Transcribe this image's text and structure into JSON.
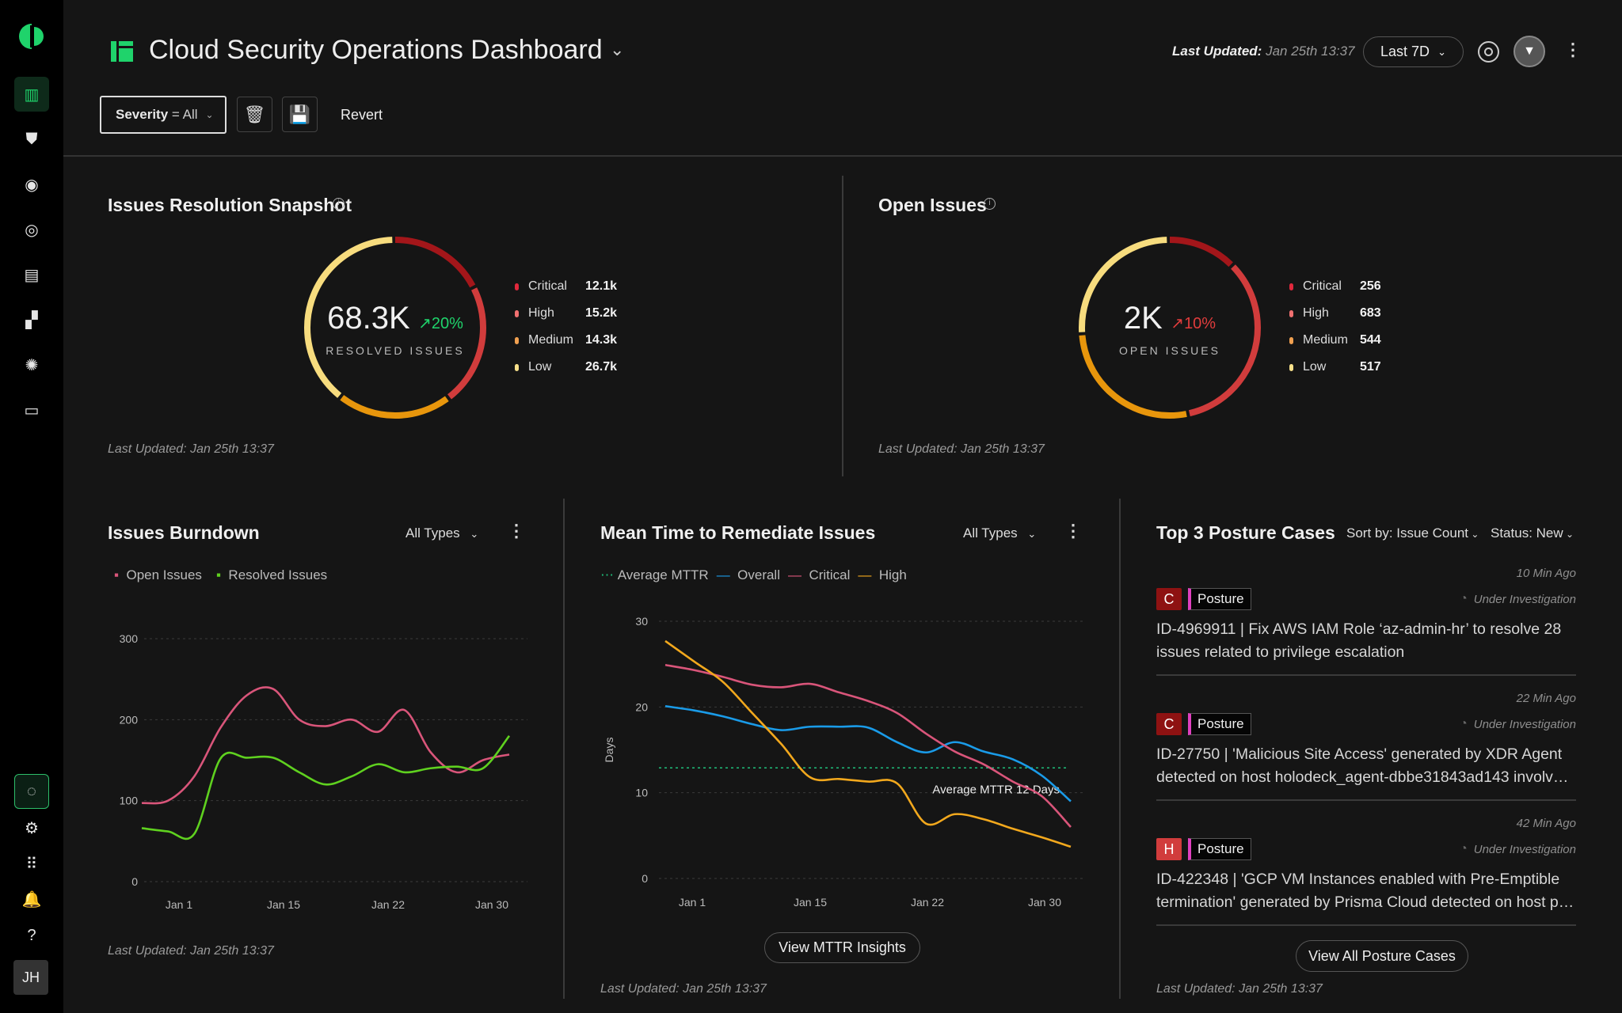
{
  "sidebar": {
    "items": [
      {
        "icon": "dashboard-icon",
        "glyph": "▥",
        "active": true
      },
      {
        "icon": "shield-alert-icon",
        "glyph": "⛊"
      },
      {
        "icon": "eye-icon",
        "glyph": "◉"
      },
      {
        "icon": "target-icon",
        "glyph": "◎"
      },
      {
        "icon": "clipboard-icon",
        "glyph": "▤"
      },
      {
        "icon": "modules-icon",
        "glyph": "▞"
      },
      {
        "icon": "network-icon",
        "glyph": "✺"
      },
      {
        "icon": "inbox-icon",
        "glyph": "▭"
      }
    ],
    "bottom": [
      {
        "icon": "radar-icon",
        "glyph": "◌"
      },
      {
        "icon": "gear-icon",
        "glyph": "⚙"
      },
      {
        "icon": "apps-grid-icon",
        "glyph": "⠿"
      },
      {
        "icon": "bell-icon",
        "glyph": "🔔"
      },
      {
        "icon": "help-icon",
        "glyph": "?"
      }
    ],
    "avatar": "JH"
  },
  "header": {
    "title": "Cloud Security Operations Dashboard",
    "last_updated_label": "Last Updated:",
    "last_updated_value": "Jan 25th 13:37",
    "range": "Last 7D"
  },
  "filters": {
    "severity_label": "Severity",
    "severity_value": "= All",
    "revert": "Revert"
  },
  "colors": {
    "accent": "#1fd36b",
    "critical": "#a3161a",
    "high": "#d13c3c",
    "medium": "#e8960c",
    "low": "#f7dc7e",
    "up_good": "#1fd36b",
    "up_bad": "#e03c3c"
  },
  "snapshot": {
    "title": "Issues Resolution Snapshot",
    "value": "68.3K",
    "trend": "20%",
    "label": "RESOLVED ISSUES",
    "last_updated": "Last Updated:  Jan 25th 13:37",
    "legend": [
      {
        "label": "Critical",
        "value": "12.1k",
        "n": 12.1
      },
      {
        "label": "High",
        "value": "15.2k",
        "n": 15.2
      },
      {
        "label": "Medium",
        "value": "14.3k",
        "n": 14.3
      },
      {
        "label": "Low",
        "value": "26.7k",
        "n": 26.7
      }
    ]
  },
  "open": {
    "title": "Open Issues",
    "value": "2K",
    "trend": "10%",
    "label": "OPEN ISSUES",
    "last_updated": "Last Updated:  Jan 25th 13:37",
    "legend": [
      {
        "label": "Critical",
        "value": "256",
        "n": 256
      },
      {
        "label": "High",
        "value": "683",
        "n": 683
      },
      {
        "label": "Medium",
        "value": "544",
        "n": 544
      },
      {
        "label": "Low",
        "value": "517",
        "n": 517
      }
    ]
  },
  "burndown": {
    "title": "Issues Burndown",
    "filter": "All Types",
    "last_updated": "Last Updated:  Jan 25th 13:37"
  },
  "mttr": {
    "title": "Mean Time to Remediate Issues",
    "filter": "All Types",
    "button": "View MTTR Insights",
    "last_updated": "Last Updated:  Jan 25th 13:37",
    "avg_label": "Average MTTR 12 Days"
  },
  "chart_data": [
    {
      "type": "line",
      "ylim": [
        0,
        300
      ],
      "yticks": [
        0,
        100,
        200,
        300
      ],
      "xticks": [
        "Jan 1",
        "Jan 15",
        "Jan 22",
        "Jan 30"
      ],
      "grid": true,
      "legend": "top-left",
      "series": [
        {
          "name": "Open Issues",
          "color": "#d9557a",
          "values": [
            97,
            100,
            130,
            190,
            230,
            238,
            200,
            192,
            200,
            185,
            212,
            160,
            135,
            150,
            157
          ]
        },
        {
          "name": "Resolved Issues",
          "color": "#5fd11f",
          "values": [
            66,
            62,
            59,
            152,
            153,
            153,
            135,
            120,
            130,
            145,
            135,
            140,
            142,
            140,
            180
          ]
        }
      ]
    },
    {
      "type": "line",
      "ylabel": "Days",
      "ylim": [
        0,
        30
      ],
      "yticks": [
        0,
        10,
        20,
        30
      ],
      "xticks": [
        "Jan 1",
        "Jan 15",
        "Jan 22",
        "Jan 30"
      ],
      "grid": true,
      "legend": "top-left",
      "average": {
        "name": "Average MTTR",
        "value": 12,
        "color": "#1fbf7a"
      },
      "series": [
        {
          "name": "Overall",
          "color": "#1a9be8",
          "values": [
            20.1,
            19.6,
            18.9,
            18,
            17.3,
            17.7,
            17.7,
            17.6,
            15.9,
            14.7,
            15.9,
            14.8,
            13.9,
            12,
            9
          ]
        },
        {
          "name": "Critical",
          "color": "#d9557a",
          "values": [
            24.9,
            24.3,
            23.5,
            22.6,
            22.3,
            22.7,
            21.7,
            20.7,
            19.3,
            16.9,
            14.8,
            13.3,
            11.3,
            9.6,
            6
          ]
        },
        {
          "name": "High",
          "color": "#f2a81d",
          "values": [
            27.7,
            25.3,
            22.9,
            19.3,
            15.7,
            11.8,
            11.6,
            11.3,
            11.1,
            6.4,
            7.5,
            6.9,
            5.8,
            4.8,
            3.7
          ]
        }
      ]
    }
  ],
  "posture": {
    "title": "Top 3 Posture Cases",
    "sort": "Sort by: Issue Count",
    "status_filter": "Status: New",
    "button": "View All Posture Cases",
    "last_updated": "Last Updated:  Jan 25th 13:37",
    "cases": [
      {
        "time": "10 Min Ago",
        "sev": "C",
        "sev_color": "#8e1212",
        "tag": "Posture",
        "status": "Under Investigation",
        "text": "ID-4969911 | Fix AWS IAM Role ‘az-admin-hr’ to resolve 28 issues related to privilege escalation"
      },
      {
        "time": "22 Min Ago",
        "sev": "C",
        "sev_color": "#8e1212",
        "tag": "Posture",
        "status": "Under Investigation",
        "text": "ID-27750 | 'Malicious Site Access' generated by XDR Agent detected on host holodeck_agent-dbbe31843ad143 involv…"
      },
      {
        "time": "42 Min Ago",
        "sev": "H",
        "sev_color": "#d13c3c",
        "tag": "Posture",
        "status": "Under Investigation",
        "text": "ID-422348 | 'GCP VM Instances enabled with Pre-Emptible termination' generated by Prisma Cloud detected on host p…"
      }
    ]
  }
}
